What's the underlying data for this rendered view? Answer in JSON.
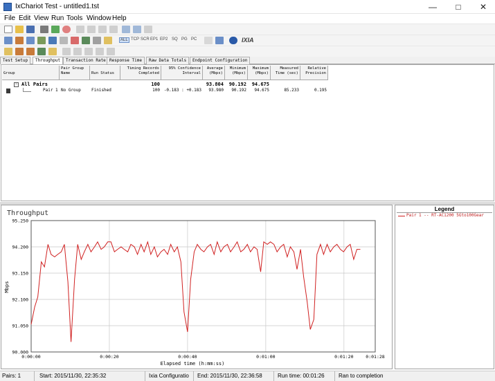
{
  "window": {
    "title": "IxChariot Test - untitled1.tst"
  },
  "menu": [
    "File",
    "Edit",
    "View",
    "Run",
    "Tools",
    "Window",
    "Help"
  ],
  "toolbar2_labels": [
    "ALL",
    "TCP",
    "SCR",
    "EP1",
    "EP2",
    "SQ",
    "PG",
    "PC"
  ],
  "brand": "IXIA",
  "tabs": [
    "Test Setup",
    "Throughput",
    "Transaction Rate",
    "Response Time",
    "Raw Data Totals",
    "Endpoint Configuration"
  ],
  "active_tab": 1,
  "grid": {
    "headers": {
      "group": "Group",
      "pair_group_name": "Pair Group Name",
      "run_status": "Run Status",
      "timing_records": "Timing Records Completed",
      "confidence": "95% Confidence Interval",
      "average": "Average (Mbps)",
      "minimum": "Minimum (Mbps)",
      "maximum": "Maximum (Mbps)",
      "measured_time": "Measured Time (sec)",
      "relative_precision": "Relative Precision"
    },
    "all_pairs": {
      "label": "All Pairs",
      "records": "100",
      "average": "93.804",
      "minimum": "90.192",
      "maximum": "94.675"
    },
    "pair1": {
      "group": "Pair 1",
      "pair_group_name": "No Group",
      "run_status": "Finished",
      "records": "100",
      "confidence": "-0.183 : +0.183",
      "average": "93.980",
      "minimum": "90.192",
      "maximum": "94.675",
      "measured_time": "85.233",
      "relative_precision": "0.195"
    }
  },
  "legend": {
    "title": "Legend",
    "entry": "Pair 1 -- RT-AC1200 5Gto100Gear"
  },
  "status": {
    "pairs": "Pairs: 1",
    "start": "Start: 2015/11/30, 22:35:32",
    "config": "Ixia Configuratio",
    "end": "End: 2015/11/30, 22:36:58",
    "runtime": "Run time: 00:01:26",
    "result": "Ran to completion"
  },
  "chart_data": {
    "type": "line",
    "title": "Throughput",
    "xlabel": "Elapsed time (h:mm:ss)",
    "ylabel": "Mbps",
    "ylim": [
      90.0,
      95.25
    ],
    "xlim": [
      0,
      88
    ],
    "yticks": [
      90.0,
      91.05,
      92.1,
      93.15,
      94.2,
      95.25
    ],
    "ytick_labels": [
      "90.000",
      "91.050",
      "92.100",
      "93.150",
      "94.200",
      "95.250"
    ],
    "xticks": [
      0,
      20,
      40,
      60,
      80,
      88
    ],
    "xtick_labels": [
      "0:00:00",
      "0:00:20",
      "0:00:40",
      "0:01:00",
      "0:01:20",
      "0:01:28"
    ],
    "grid": true,
    "series": [
      {
        "name": "Pair 1 -- RT-AC1200 5Gto100Gear",
        "color": "#d02020",
        "x": [
          0.0,
          0.9,
          1.7,
          2.6,
          3.4,
          4.3,
          5.1,
          6.0,
          6.8,
          7.7,
          8.5,
          9.4,
          10.2,
          11.1,
          11.9,
          12.8,
          13.6,
          14.5,
          15.3,
          16.2,
          17.0,
          17.9,
          18.7,
          19.6,
          20.4,
          21.3,
          22.1,
          23.0,
          23.8,
          24.7,
          25.5,
          26.4,
          27.2,
          28.1,
          28.9,
          29.8,
          30.6,
          31.5,
          32.3,
          33.2,
          34.0,
          34.9,
          35.7,
          36.6,
          37.4,
          38.3,
          39.1,
          40.0,
          40.8,
          41.7,
          42.5,
          43.4,
          44.2,
          45.1,
          45.9,
          46.8,
          47.6,
          48.5,
          49.3,
          50.2,
          51.0,
          51.9,
          52.7,
          53.6,
          54.4,
          55.3,
          56.1,
          57.0,
          57.8,
          58.7,
          59.5,
          60.4,
          61.2,
          62.1,
          62.9,
          63.8,
          64.6,
          65.5,
          66.3,
          67.2,
          68.0,
          68.9,
          69.7,
          70.6,
          71.4,
          72.3,
          73.1,
          74.0,
          74.8,
          75.7,
          76.5,
          77.4,
          78.2,
          79.1,
          79.9,
          80.8,
          81.6,
          82.5,
          83.3,
          84.2
        ],
        "y": [
          91.1,
          91.8,
          92.2,
          93.6,
          93.4,
          94.3,
          93.9,
          93.8,
          93.9,
          94.0,
          94.3,
          92.8,
          90.4,
          92.9,
          94.3,
          93.7,
          94.0,
          94.3,
          94.0,
          94.2,
          94.4,
          94.1,
          94.2,
          94.4,
          94.4,
          94.0,
          94.1,
          94.2,
          94.1,
          94.0,
          94.3,
          94.2,
          93.9,
          94.3,
          94.0,
          94.4,
          93.9,
          94.2,
          93.8,
          94.0,
          94.1,
          93.9,
          94.3,
          94.0,
          94.2,
          93.6,
          91.6,
          90.8,
          92.9,
          94.0,
          94.3,
          94.1,
          94.0,
          94.2,
          94.3,
          93.9,
          94.4,
          94.0,
          94.2,
          94.3,
          94.0,
          94.2,
          94.4,
          94.0,
          94.1,
          94.3,
          94.0,
          94.2,
          94.1,
          93.2,
          94.4,
          94.3,
          94.4,
          94.3,
          94.0,
          94.2,
          94.3,
          93.8,
          94.2,
          94.0,
          93.3,
          94.1,
          93.0,
          92.0,
          90.9,
          91.3,
          93.9,
          94.3,
          93.9,
          94.3,
          94.0,
          94.2,
          94.3,
          94.1,
          94.0,
          94.2,
          94.3,
          93.7,
          94.1,
          94.1
        ]
      }
    ]
  }
}
